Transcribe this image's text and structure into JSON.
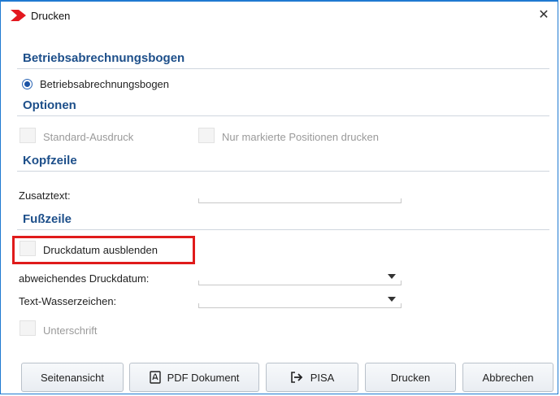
{
  "window": {
    "title": "Drucken",
    "close_glyph": "✕",
    "accent_color": "#1f7ad1",
    "logo_color": "#e3181f"
  },
  "sections": {
    "betrieb": {
      "header": "Betriebsabrechnungsbogen",
      "radio_label": "Betriebsabrechnungsbogen",
      "radio_selected": true
    },
    "optionen": {
      "header": "Optionen",
      "standard_label": "Standard-Ausdruck",
      "standard_checked": false,
      "markierte_label": "Nur markierte Positionen drucken",
      "markierte_checked": false
    },
    "kopfzeile": {
      "header": "Kopfzeile",
      "zusatztext_label": "Zusatztext:",
      "zusatztext_value": ""
    },
    "fusszeile": {
      "header": "Fußzeile",
      "druckdatum_label": "Druckdatum ausblenden",
      "druckdatum_checked": false,
      "abweichend_label": "abweichendes Druckdatum:",
      "abweichend_value": "",
      "wasserzeichen_label": "Text-Wasserzeichen:",
      "wasserzeichen_value": "",
      "unterschrift_label": "Unterschrift",
      "unterschrift_checked": false
    }
  },
  "highlight_color": "#e01b1b",
  "buttons": {
    "seitenansicht": "Seitenansicht",
    "pdf": "PDF Dokument",
    "pisa": "PISA",
    "drucken": "Drucken",
    "abbrechen": "Abbrechen"
  },
  "icons": {
    "logo": "chevron-logo-icon",
    "close": "close-icon",
    "pdf": "pdf-icon",
    "pisa": "export-arrow-icon",
    "dropdown": "dropdown-arrow-icon"
  }
}
